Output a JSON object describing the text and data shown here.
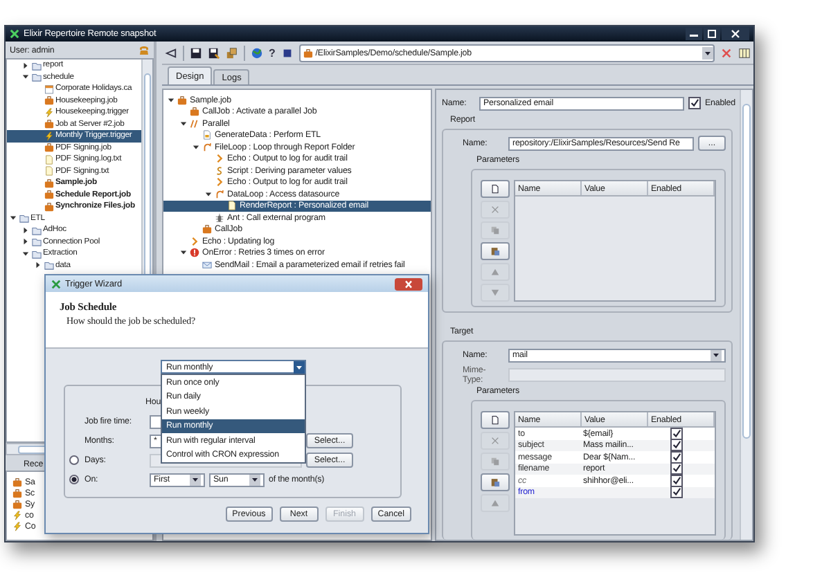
{
  "window": {
    "title": "Elixir Repertoire Remote snapshot"
  },
  "sidebar": {
    "user": "User: admin",
    "tree": [
      {
        "kind": "continuation",
        "children": [
          {
            "label": "report",
            "kind": "folder",
            "expanded": false,
            "selected": false,
            "bold": false
          },
          {
            "label": "schedule",
            "kind": "folder",
            "expanded": true,
            "selected": false,
            "bold": false,
            "children": [
              {
                "label": "Corporate Holidays.ca",
                "kind": "calendar",
                "selected": false,
                "bold": false
              },
              {
                "label": "Housekeeping.job",
                "kind": "job",
                "selected": false,
                "bold": false
              },
              {
                "label": "Housekeeping.trigger",
                "kind": "trigger",
                "selected": false,
                "bold": false
              },
              {
                "label": "Job at Server #2.job",
                "kind": "job",
                "selected": false,
                "bold": false
              },
              {
                "label": "Monthly Trigger.trigger",
                "kind": "trigger",
                "selected": true,
                "bold": false
              },
              {
                "label": "PDF Signing.job",
                "kind": "job",
                "selected": false,
                "bold": false
              },
              {
                "label": "PDF Signing.log.txt",
                "kind": "text",
                "selected": false,
                "bold": false
              },
              {
                "label": "PDF Signing.txt",
                "kind": "text",
                "selected": false,
                "bold": false
              },
              {
                "label": "Sample.job",
                "kind": "job",
                "selected": false,
                "bold": true
              },
              {
                "label": "Schedule Report.job",
                "kind": "job",
                "selected": false,
                "bold": true
              },
              {
                "label": "Synchronize Files.job",
                "kind": "job",
                "selected": false,
                "bold": true
              }
            ]
          }
        ]
      },
      {
        "label": "ETL",
        "kind": "folder",
        "expanded": true,
        "selected": false,
        "bold": false,
        "children": [
          {
            "label": "AdHoc",
            "kind": "folder",
            "expanded": false,
            "selected": false,
            "bold": false
          },
          {
            "label": "Connection Pool",
            "kind": "folder",
            "expanded": false,
            "selected": false,
            "bold": false
          },
          {
            "label": "Extraction",
            "kind": "folder",
            "expanded": true,
            "selected": false,
            "bold": false,
            "children": [
              {
                "label": "data",
                "kind": "folder",
                "expanded": false,
                "selected": false,
                "bold": false
              }
            ]
          }
        ]
      }
    ],
    "recent_tab": "Rece",
    "recent": [
      {
        "label": "Sa",
        "kind": "job"
      },
      {
        "label": "Sc",
        "kind": "job"
      },
      {
        "label": "Sy",
        "kind": "job"
      },
      {
        "label": "co",
        "kind": "trigger"
      },
      {
        "label": "Co",
        "kind": "trigger"
      }
    ]
  },
  "toolbar": {
    "help": "?",
    "path": "/ElixirSamples/Demo/schedule/Sample.job"
  },
  "tabs": [
    {
      "label": "Design",
      "selected": true
    },
    {
      "label": "Logs",
      "selected": false
    }
  ],
  "job_tree": [
    {
      "label": "Sample.job",
      "kind": "job",
      "expanded": true,
      "selected": false,
      "children": [
        {
          "label": "CallJob : Activate a parallel Job",
          "kind": "job",
          "selected": false
        },
        {
          "label": "Parallel",
          "kind": "parallel",
          "expanded": true,
          "selected": false,
          "children": [
            {
              "label": "GenerateData : Perform ETL",
              "kind": "data",
              "selected": false
            },
            {
              "label": "FileLoop : Loop through Report Folder",
              "kind": "loop",
              "expanded": true,
              "selected": false,
              "children": [
                {
                  "label": "Echo : Output to log for audit trail",
                  "kind": "echo",
                  "selected": false
                },
                {
                  "label": "Script : Deriving parameter values",
                  "kind": "script",
                  "selected": false
                },
                {
                  "label": "Echo : Output to log for audit trail",
                  "kind": "echo",
                  "selected": false
                },
                {
                  "label": "DataLoop : Access datasource",
                  "kind": "loop",
                  "expanded": true,
                  "selected": false,
                  "children": [
                    {
                      "label": "RenderReport : Personalized email",
                      "kind": "render",
                      "selected": true
                    }
                  ]
                },
                {
                  "label": "Ant : Call external program",
                  "kind": "ant",
                  "selected": false
                }
              ]
            },
            {
              "label": "CallJob",
              "kind": "job",
              "selected": false
            }
          ]
        },
        {
          "label": "Echo : Updating log",
          "kind": "echo",
          "selected": false
        },
        {
          "label": "OnError : Retries 3 times on error",
          "kind": "error",
          "expanded": true,
          "selected": false,
          "children": [
            {
              "label": "SendMail : Email a parameterized email if retries fail",
              "kind": "mail",
              "selected": false
            }
          ]
        }
      ]
    }
  ],
  "properties": {
    "name_label": "Name:",
    "name": "Personalized email",
    "enabled_label": "Enabled",
    "enabled": true,
    "report": {
      "title": "Report",
      "name_label": "Name:",
      "name": "repository:/ElixirSamples/Resources/Send Re",
      "browse": "...",
      "params_title": "Parameters",
      "columns": [
        "Name",
        "Value",
        "Enabled"
      ],
      "buttons": [
        {
          "kind": "new",
          "disabled": false
        },
        {
          "kind": "delete",
          "disabled": true
        },
        {
          "kind": "copy",
          "disabled": true
        },
        {
          "kind": "paste",
          "disabled": false
        },
        {
          "kind": "up",
          "disabled": true
        },
        {
          "kind": "down",
          "disabled": true
        }
      ]
    },
    "target": {
      "title": "Target",
      "name_label": "Name:",
      "name": "mail",
      "mime_label": "Mime-Type:",
      "params_title": "Parameters",
      "columns": [
        "Name",
        "Value",
        "Enabled"
      ],
      "buttons": [
        {
          "kind": "new",
          "disabled": false
        },
        {
          "kind": "delete",
          "disabled": true
        },
        {
          "kind": "copy",
          "disabled": true
        },
        {
          "kind": "paste",
          "disabled": false
        },
        {
          "kind": "up",
          "disabled": true
        }
      ],
      "rows": [
        {
          "name": "to",
          "value": "${email}",
          "enabled": true,
          "kind": "standard"
        },
        {
          "name": "subject",
          "value": "Mass mailin...",
          "enabled": true,
          "kind": "standard"
        },
        {
          "name": "message",
          "value": "Dear ${Nam...",
          "enabled": true,
          "kind": "standard"
        },
        {
          "name": "filename",
          "value": "report",
          "enabled": true,
          "kind": "standard"
        },
        {
          "name": "cc",
          "value": "shihhor@eli...",
          "enabled": true,
          "kind": "optional"
        },
        {
          "name": "from",
          "enabled": true,
          "kind": "custom"
        }
      ]
    }
  },
  "dialog": {
    "title": "Trigger Wizard",
    "heading": "Job Schedule",
    "subheading": "How should the job be scheduled?",
    "schedule": {
      "value": "Run monthly",
      "options": [
        {
          "label": "Run once only",
          "selected": false
        },
        {
          "label": "Run daily",
          "selected": false
        },
        {
          "label": "Run weekly",
          "selected": false
        },
        {
          "label": "Run monthly",
          "selected": true
        },
        {
          "label": "Run with regular interval",
          "selected": false
        },
        {
          "label": "Control with CRON expression",
          "selected": false
        }
      ]
    },
    "hours_label": "Hou",
    "fire_time_label": "Job fire time:",
    "months_label": "Months:",
    "months": "*",
    "select_months": "Select...",
    "days_label": "Days:",
    "days_selected": false,
    "select_days": "Select...",
    "on_label": "On:",
    "on_selected": true,
    "ordinal": "First",
    "weekday": "Sun",
    "of_month": "of the month(s)",
    "buttons": [
      {
        "label": "Previous",
        "disabled": false
      },
      {
        "label": "Next",
        "disabled": false
      },
      {
        "label": "Finish",
        "disabled": true
      },
      {
        "label": "Cancel",
        "disabled": false
      }
    ]
  }
}
